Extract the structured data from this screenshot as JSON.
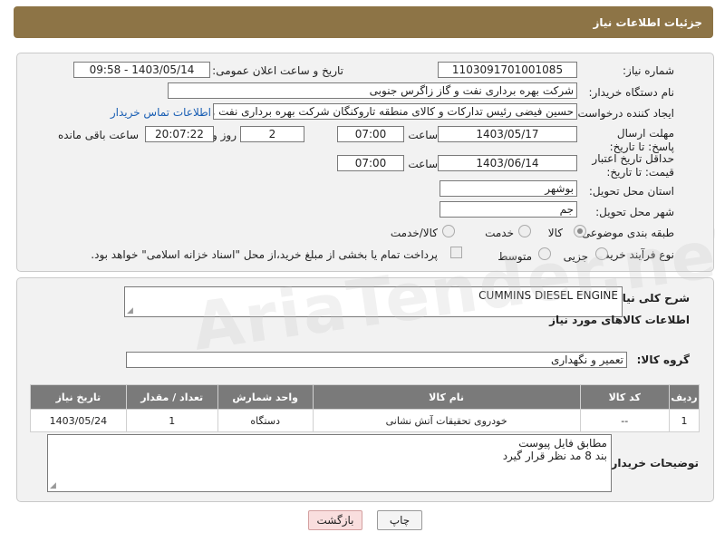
{
  "header": {
    "title": "جزئیات اطلاعات نیاز"
  },
  "form": {
    "need_number_label": "شماره نیاز:",
    "need_number": "1103091701001085",
    "announce_label": "تاریخ و ساعت اعلان عمومی:",
    "announce_value": "1403/05/14 - 09:58",
    "buyer_label": "نام دستگاه خریدار:",
    "buyer_value": "شرکت بهره برداری نفت و گاز زاگرس جنوبی",
    "creator_label": "ایجاد کننده درخواست:",
    "creator_value": "حسین فیضی رئیس تدارکات و کالای منطقه تاروکنگان شرکت بهره برداری نفت و",
    "contact_link": "اطلاعات تماس خریدار",
    "deadline_label": "مهلت ارسال پاسخ: تا تاریخ:",
    "deadline_date": "1403/05/17",
    "time_label": "ساعت",
    "deadline_time": "07:00",
    "days_value": "2",
    "day_and_label": "روز و",
    "remaining_time": "20:07:22",
    "remaining_label": "ساعت باقی مانده",
    "validity_label": "حداقل تاریخ اعتبار قیمت: تا تاریخ:",
    "validity_date": "1403/06/14",
    "validity_time": "07:00",
    "province_label": "استان محل تحویل:",
    "province_value": "بوشهر",
    "city_label": "شهر محل تحویل:",
    "city_value": "جم",
    "category_label": "طبقه بندی موضوعی:",
    "category_options": [
      "کالا",
      "خدمت",
      "کالا/خدمت"
    ],
    "process_label": "نوع فرآیند خرید :",
    "process_options": [
      "جزیی",
      "متوسط"
    ],
    "payment_note": "پرداخت تمام یا بخشی از مبلغ خرید،از محل \"اسناد خزانه اسلامی\" خواهد بود."
  },
  "details": {
    "summary_label": "شرح کلی نیاز:",
    "summary_value": "CUMMINS DIESEL ENGINE",
    "goods_info_title": "اطلاعات کالاهای مورد نیاز",
    "group_label": "گروه کالا:",
    "group_value": "تعمیر و نگهداری",
    "table": {
      "headers": [
        "ردیف",
        "کد کالا",
        "نام کالا",
        "واحد شمارش",
        "تعداد / مقدار",
        "تاریخ نیاز"
      ],
      "rows": [
        [
          "1",
          "--",
          "خودروی تحقیقات آتش نشانی",
          "دستگاه",
          "1",
          "1403/05/24"
        ]
      ]
    },
    "buyer_notes_label": "توضیحات خریدار:",
    "buyer_notes_line1": "مطابق فایل پیوست",
    "buyer_notes_line2": "بند 8 مد نظر قرار گیرد"
  },
  "buttons": {
    "print": "چاپ",
    "back": "بازگشت"
  },
  "watermark": "AriaTender.neT",
  "colors": {
    "header": "#8d7446",
    "table_header": "#7a7a7a",
    "link": "#1a5fb4",
    "back_button": "#f9dede"
  }
}
